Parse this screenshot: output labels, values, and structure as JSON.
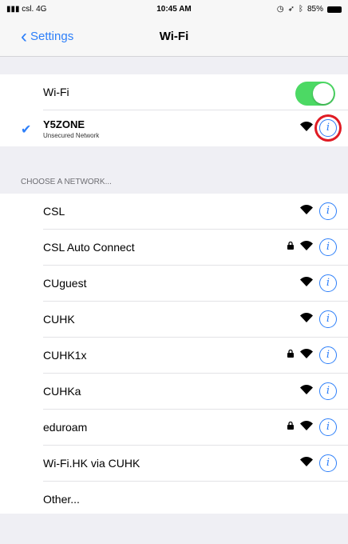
{
  "status": {
    "carrier": "csl.",
    "network": "4G",
    "time": "10:45 AM",
    "battery": "85%"
  },
  "nav": {
    "back_label": "Settings",
    "title": "Wi-Fi"
  },
  "wifi_toggle": {
    "label": "Wi-Fi",
    "on": true
  },
  "connected": {
    "name": "Y5ZONE",
    "subtitle": "Unsecured Network"
  },
  "section_header": "CHOOSE A NETWORK...",
  "networks": [
    {
      "name": "CSL",
      "locked": false
    },
    {
      "name": "CSL Auto Connect",
      "locked": true
    },
    {
      "name": "CUguest",
      "locked": false
    },
    {
      "name": "CUHK",
      "locked": false
    },
    {
      "name": "CUHK1x",
      "locked": true
    },
    {
      "name": "CUHKa",
      "locked": false
    },
    {
      "name": "eduroam",
      "locked": true
    },
    {
      "name": "Wi-Fi.HK via CUHK",
      "locked": false
    }
  ],
  "other_label": "Other...",
  "colors": {
    "accent": "#2d7ff9",
    "toggle_on": "#4cd964",
    "highlight": "#e01b24"
  },
  "icons": {
    "wifi": "wifi-icon",
    "lock": "lock-icon",
    "info": "info-icon",
    "check": "checkmark-icon",
    "back": "chevron-left-icon"
  }
}
